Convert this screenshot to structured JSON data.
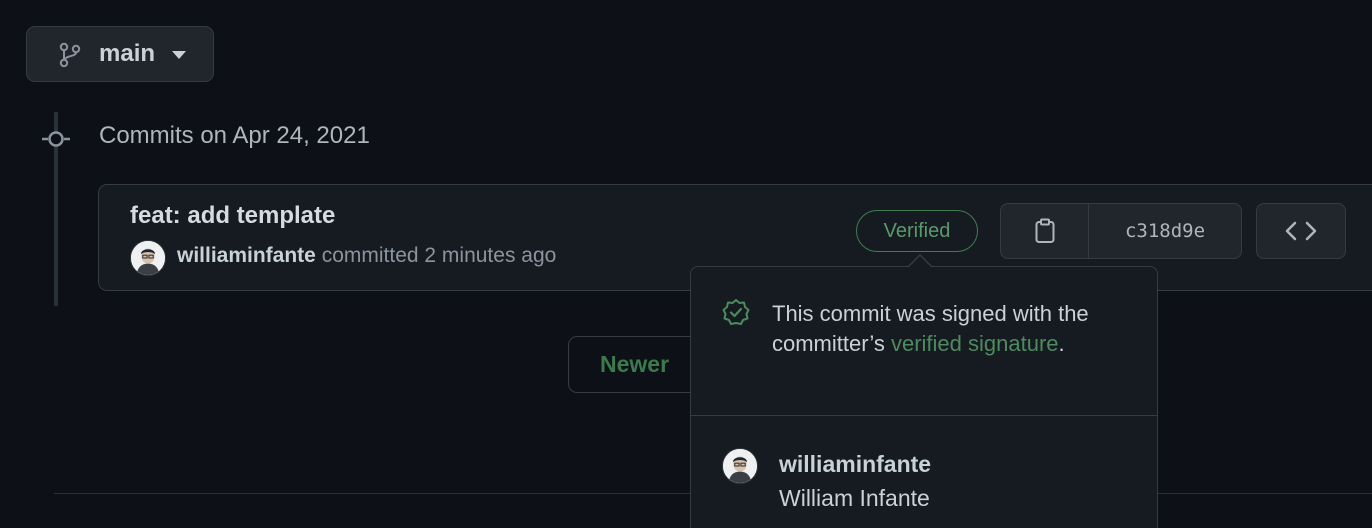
{
  "branch": {
    "name": "main",
    "icon": "git-branch-icon"
  },
  "timeline": {
    "date_heading": "Commits on Apr 24, 2021"
  },
  "commit": {
    "title": "feat: add template",
    "author": "williaminfante",
    "action": "committed",
    "time_ago": "2 minutes ago",
    "verified_label": "Verified",
    "sha": "c318d9e"
  },
  "pagination": {
    "newer_label": "Newer"
  },
  "popover": {
    "message_prefix": "This commit was signed with the committer’s ",
    "link_text": "verified signature",
    "message_suffix": ".",
    "signer_login": "williaminfante",
    "signer_name": "William Infante"
  },
  "colors": {
    "background": "#0d1117",
    "panel": "#161b22",
    "border": "#363b42",
    "verified_green": "#5b9a6b"
  }
}
